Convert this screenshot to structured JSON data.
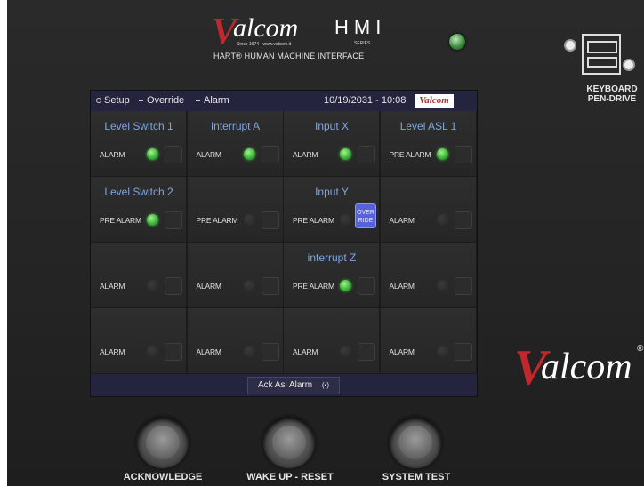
{
  "brand": {
    "logo_letter": "V",
    "logo_word": "alcom",
    "logo_reg": "®",
    "since": "Since 1974 · www.valcom.it",
    "hmi": "HMI",
    "series": "SERIES",
    "subtitle": "HART® HUMAN MACHINE INTERFACE"
  },
  "device": {
    "keyboard_label_line1": "KEYBOARD",
    "keyboard_label_line2": "PEN-DRIVE"
  },
  "screen": {
    "nav": [
      {
        "label": "Setup"
      },
      {
        "label": "Override"
      },
      {
        "label": "Alarm"
      }
    ],
    "datetime": "10/19/2031 - 10:08",
    "mini_logo": "Valcom",
    "cells": [
      {
        "name": "Level Switch 1",
        "status": "ALARM",
        "led_on": true
      },
      {
        "name": "Interrupt A",
        "status": "ALARM",
        "led_on": true
      },
      {
        "name": "Input X",
        "status": "ALARM",
        "led_on": true
      },
      {
        "name": "Level ASL 1",
        "status": "PRE ALARM",
        "led_on": true
      },
      {
        "name": "Level Switch 2",
        "status": "PRE ALARM",
        "led_on": true
      },
      {
        "name": "",
        "status": "PRE ALARM",
        "led_on": false
      },
      {
        "name": "Input Y",
        "status": "PRE ALARM",
        "led_on": false,
        "override": "OVER RIDE"
      },
      {
        "name": "",
        "status": "ALARM",
        "led_on": false
      },
      {
        "name": "",
        "status": "ALARM",
        "led_on": false
      },
      {
        "name": "",
        "status": "ALARM",
        "led_on": false
      },
      {
        "name": "interrupt Z",
        "status": "PRE ALARM",
        "led_on": true
      },
      {
        "name": "",
        "status": "ALARM",
        "led_on": false
      },
      {
        "name": "",
        "status": "ALARM",
        "led_on": false
      },
      {
        "name": "",
        "status": "ALARM",
        "led_on": false
      },
      {
        "name": "",
        "status": "ALARM",
        "led_on": false
      },
      {
        "name": "",
        "status": "ALARM",
        "led_on": false
      }
    ],
    "ack_button": "Ack Asl Alarm",
    "ack_icon": "(▪)"
  },
  "big_brand": {
    "letter": "V",
    "word": "alcom",
    "reg": "®"
  },
  "buttons": [
    {
      "label": "ACKNOWLEDGE"
    },
    {
      "label": "WAKE UP - RESET"
    },
    {
      "label": "SYSTEM TEST"
    }
  ],
  "colors": {
    "brand_red": "#c0282d",
    "cell_title_blue": "#7ea6de",
    "led_green": "#3bb53b",
    "override_blue": "#5762d9"
  }
}
